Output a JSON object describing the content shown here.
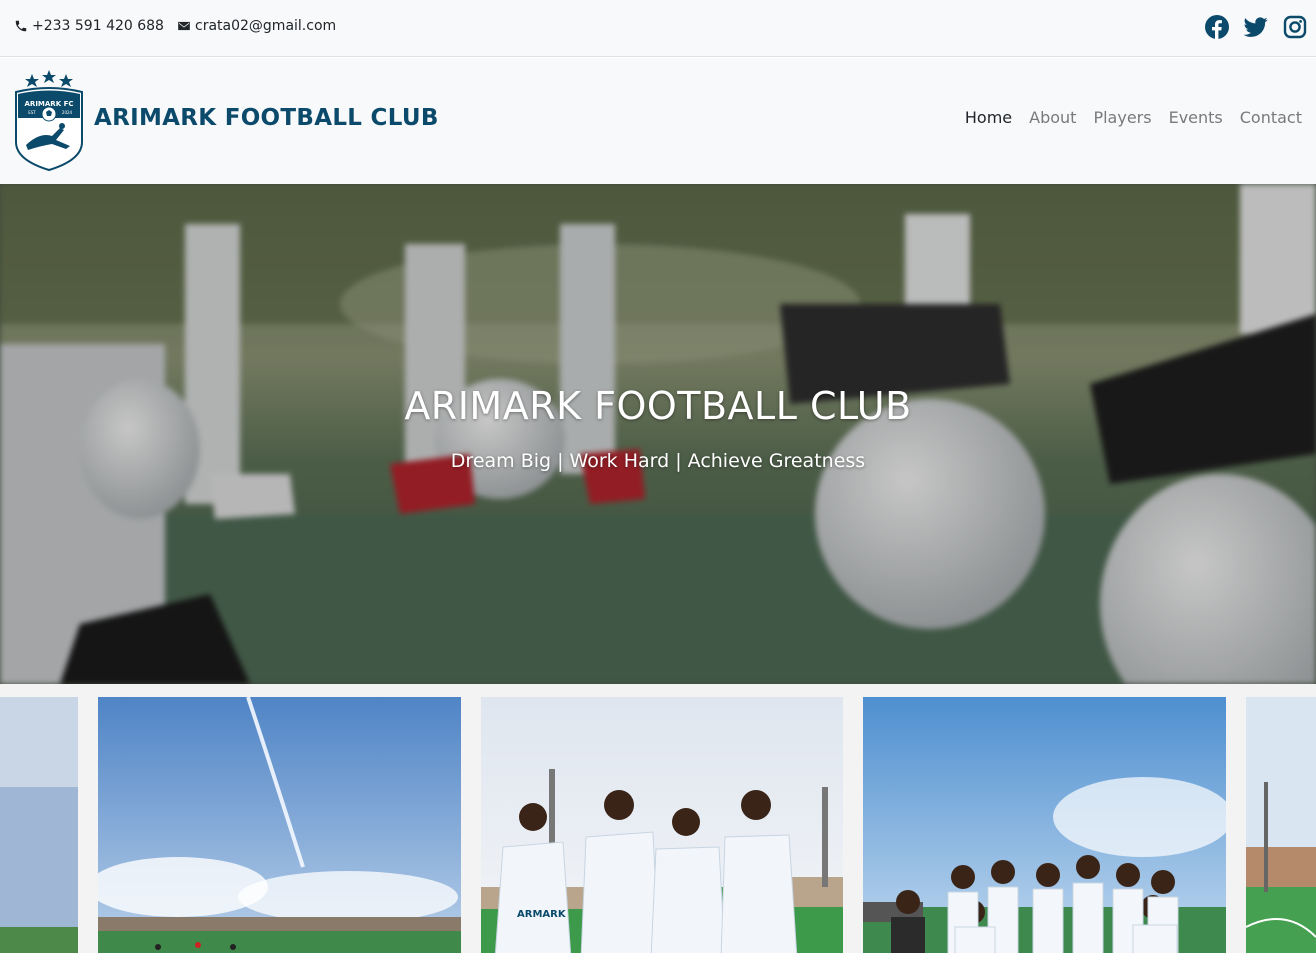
{
  "contact": {
    "phone": "+233 591 420 688",
    "email": "crata02@gmail.com",
    "phone_icon": "phone-icon",
    "email_icon": "envelope-icon"
  },
  "social": [
    "facebook-icon",
    "twitter-icon",
    "instagram-icon"
  ],
  "brand": {
    "name": "ARIMARK FOOTBALL CLUB",
    "logo_text": "ARIMARK FC",
    "logo_est": "EST",
    "logo_year": "2024"
  },
  "nav": {
    "items": [
      {
        "label": "Home",
        "active": true
      },
      {
        "label": "About",
        "active": false
      },
      {
        "label": "Players",
        "active": false
      },
      {
        "label": "Events",
        "active": false
      },
      {
        "label": "Contact",
        "active": false
      }
    ]
  },
  "hero": {
    "title": "ARIMARK FOOTBALL CLUB",
    "subtitle": "Dream Big | Work Hard | Achieve Greatness"
  },
  "gallery": {
    "photos": [
      "field-sky-photo",
      "field-wide-photo",
      "team-four-players-photo",
      "team-group-photo",
      "field-stadium-photo"
    ],
    "jersey_text": "ARMARK"
  },
  "colors": {
    "brand": "#0b4a6b",
    "topbar_bg": "#f8f9fa",
    "nav_active": "#212529",
    "nav_inactive": "#7a7a7a"
  }
}
